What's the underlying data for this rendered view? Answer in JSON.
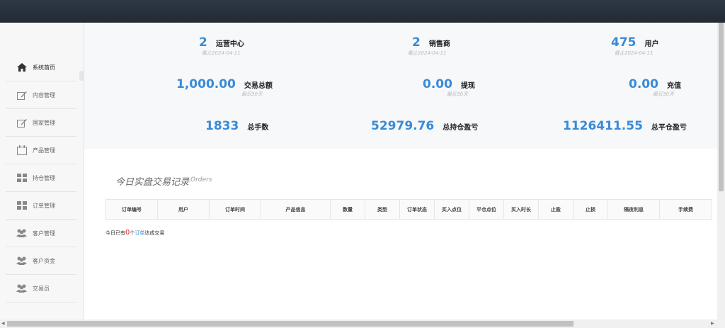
{
  "sidebar": {
    "items": [
      {
        "label": "系统首页",
        "icon": "home-icon"
      },
      {
        "label": "内容管理",
        "icon": "edit-icon"
      },
      {
        "label": "国家管理",
        "icon": "edit-icon"
      },
      {
        "label": "产品管理",
        "icon": "calendar-icon"
      },
      {
        "label": "持仓管理",
        "icon": "grid-icon"
      },
      {
        "label": "订单管理",
        "icon": "grid-icon"
      },
      {
        "label": "客户管理",
        "icon": "users-icon"
      },
      {
        "label": "客户资金",
        "icon": "users-icon"
      },
      {
        "label": "交易员",
        "icon": "users-icon"
      }
    ]
  },
  "stats": {
    "ops_center": {
      "value": "2",
      "label": "运营中心",
      "sub": "截止2024-04-11"
    },
    "distributors": {
      "value": "2",
      "label": "销售商",
      "sub": "截止2024-04-11"
    },
    "users": {
      "value": "475",
      "label": "用户",
      "sub": "截止2024-04-11"
    },
    "trade_total": {
      "value": "1,000.00",
      "label": "交易总额",
      "sub": "最近30天"
    },
    "withdraw": {
      "value": "0.00",
      "label": "提现",
      "sub": "最近30天"
    },
    "recharge": {
      "value": "0.00",
      "label": "充值",
      "sub": "最近30天"
    },
    "total_lots": {
      "value": "1833",
      "label": "总手数"
    },
    "holding_pl": {
      "value": "52979.76",
      "label": "总持仓盈亏"
    },
    "closing_pl": {
      "value": "1126411.55",
      "label": "总平仓盈亏"
    }
  },
  "orders": {
    "title": "今日实盘交易记录",
    "subtitle": "Orders",
    "columns": [
      "订单编号",
      "用户",
      "订单时间",
      "产品信息",
      "数量",
      "类型",
      "订单状态",
      "买入点位",
      "平仓点位",
      "买入时长",
      "止盈",
      "止损",
      "隔夜利息",
      "手续费"
    ],
    "today_prefix": "今日已有",
    "today_count": "0",
    "today_mid": "个",
    "today_link": "订单",
    "today_suffix": "达成交易"
  }
}
